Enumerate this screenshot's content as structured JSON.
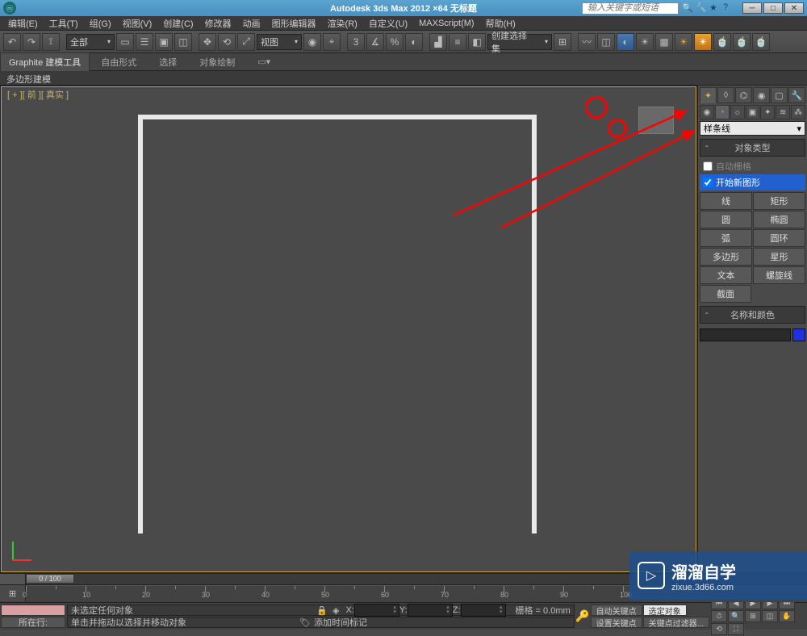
{
  "titlebar": {
    "app_title": "Autodesk 3ds Max 2012 ×64   无标题",
    "search_placeholder": "输入关键字或短语"
  },
  "menus": [
    "编辑(E)",
    "工具(T)",
    "组(G)",
    "视图(V)",
    "创建(C)",
    "修改器",
    "动画",
    "图形编辑器",
    "渲染(R)",
    "自定义(U)",
    "MAXScript(M)",
    "帮助(H)"
  ],
  "toolbar": {
    "scope": "全部",
    "view": "视图",
    "sel_set": "创建选择集"
  },
  "graphite": {
    "tab": "Graphite 建模工具",
    "sub_free": "自由形式",
    "sub_sel": "选择",
    "sub_paint": "对象绘制",
    "header": "多边形建模"
  },
  "viewport": {
    "label": "[ + ][ 前 ][ 真实 ]"
  },
  "cmdpanel": {
    "dropdown": "样条线",
    "rollout_objtype": "对象类型",
    "autogrid": "自动栅格",
    "startshape": "开始新图形",
    "buttons": {
      "line": "线",
      "rect": "矩形",
      "circle": "圆",
      "ellipse": "椭圆",
      "arc": "弧",
      "donut": "圆环",
      "ngon": "多边形",
      "star": "星形",
      "text": "文本",
      "helix": "螺旋线",
      "section": "截面"
    },
    "rollout_name": "名称和颜色"
  },
  "timeline": {
    "slider": "0 / 100",
    "autokey": "自动关键点",
    "setkey": "设置关键点",
    "selset": "选定对象",
    "keyfilter": "关键点过滤器..."
  },
  "status": {
    "none_selected": "未选定任何对象",
    "hint": "单击并拖动以选择并移动对象",
    "add_time": "添加时间标记",
    "grid": "栅格 = 0.0mm",
    "x": "X:",
    "y": "Y:",
    "z": "Z:",
    "location": "所在行:"
  },
  "watermark": {
    "main": "溜溜自学",
    "sub": "zixue.3d66.com"
  }
}
